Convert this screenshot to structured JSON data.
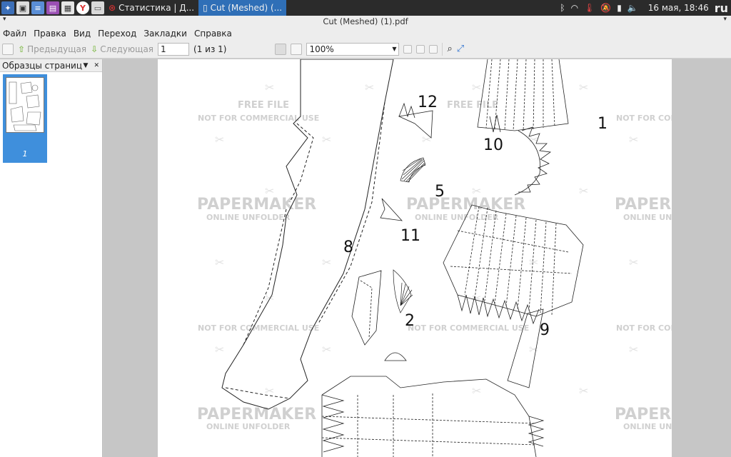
{
  "panel": {
    "tasks": [
      {
        "label": "Статистика | Д..."
      },
      {
        "label": "Cut (Meshed) (..."
      }
    ],
    "clock": "16 мая, 18:46",
    "lang": "ru"
  },
  "window": {
    "title": "Cut (Meshed) (1).pdf"
  },
  "menu": [
    "Файл",
    "Правка",
    "Вид",
    "Переход",
    "Закладки",
    "Справка"
  ],
  "toolbar": {
    "prev_label": "Предыдущая",
    "next_label": "Следующая",
    "page_value": "1",
    "page_count": "(1 из 1)",
    "zoom_value": "100%"
  },
  "sidebar": {
    "title": "Образцы страниц",
    "thumb_label": "1"
  },
  "document": {
    "part_labels": [
      "12",
      "1",
      "10",
      "5",
      "11",
      "8",
      "2",
      "9"
    ],
    "watermark_brand": "PAPERMAKER",
    "watermark_sub": "ONLINE UNFOLDER",
    "watermark_free": "FREE FILE",
    "watermark_notfor": "NOT FOR COMMERCIAL USE"
  },
  "colors": {
    "panel_bg": "#2b2b2b",
    "active_task": "#2f6fb7",
    "thumb_selected": "#3f8fdc"
  }
}
